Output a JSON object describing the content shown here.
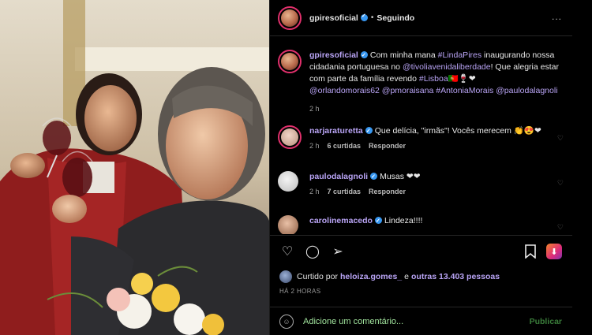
{
  "post": {
    "author": "gpiresoficial",
    "follow_status": "Seguindo",
    "more": "...",
    "caption_parts": {
      "p1": "Com minha mana ",
      "tag1": "#LindaPires",
      "p2": " inaugurando nossa cidadania portuguesa no ",
      "tag2": "@tivoliavenidaliberdade",
      "p3": "! Que alegria estar com parte da família revendo ",
      "tag3": "#Lisboa",
      "p4": "🇵🇹🍷❤",
      "tag4": "@orlandomorais62",
      "tag5": "@pmoraisana",
      "tag6": "#AntoniaMorais",
      "tag7": "@paulodalagnoli"
    },
    "caption_time": "2 h"
  },
  "comments": [
    {
      "user": "narjaraturetta",
      "text": "Que delícia, \"irmãs\"! Vocês merecem 👏😍❤",
      "time": "2 h",
      "likes": "6 curtidas",
      "reply": "Responder"
    },
    {
      "user": "paulodalagnoli",
      "text": "Musas ❤❤",
      "time": "2 h",
      "likes": "7 curtidas",
      "reply": "Responder"
    },
    {
      "user": "carolinemacedo",
      "text": "Lindeza!!!!"
    }
  ],
  "likes": {
    "prefix": "Curtido por",
    "user": "heloiza.gomes_",
    "connector": "e",
    "others": "outras 13.403 pessoas"
  },
  "posted": "HÁ 2 HORAS",
  "composer": {
    "placeholder": "Adicione um comentário...",
    "publish": "Publicar"
  },
  "colors": {
    "link": "#b9a4f5",
    "verified": "#3897f0",
    "input_text": "#a0e29c"
  },
  "icons": [
    "heart-icon",
    "comment-icon",
    "share-icon",
    "bookmark-icon",
    "download-icon",
    "emoji-icon"
  ]
}
